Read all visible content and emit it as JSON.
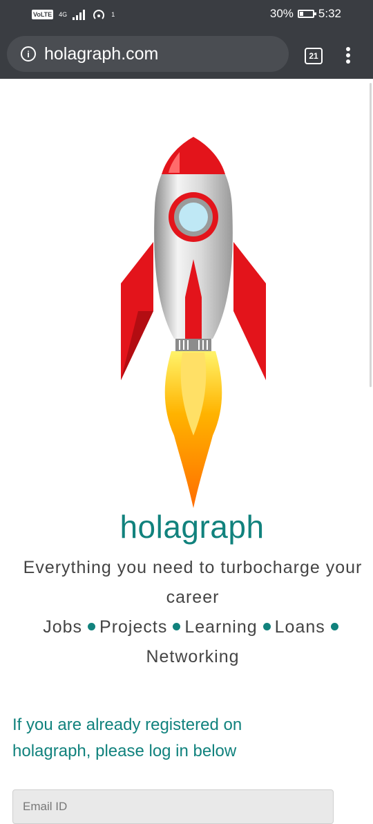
{
  "status_bar": {
    "network": "VoLTE",
    "network_type": "4G",
    "notification_count": "1",
    "battery_percent": "30%",
    "battery_level": 0.3,
    "time": "5:32"
  },
  "browser": {
    "url": "holagraph.com",
    "tab_count": "21"
  },
  "hero": {
    "brand": "holagraph",
    "tagline": "Everything you need to turbocharge your career",
    "features": [
      "Jobs",
      "Projects",
      "Learning",
      "Loans",
      "Networking"
    ]
  },
  "login": {
    "message": "If you are already registered on holagraph, please log in below",
    "email_placeholder": "Email ID"
  },
  "colors": {
    "accent": "#11827d",
    "chrome": "#3a3d42",
    "rocket_red": "#e3141b"
  }
}
